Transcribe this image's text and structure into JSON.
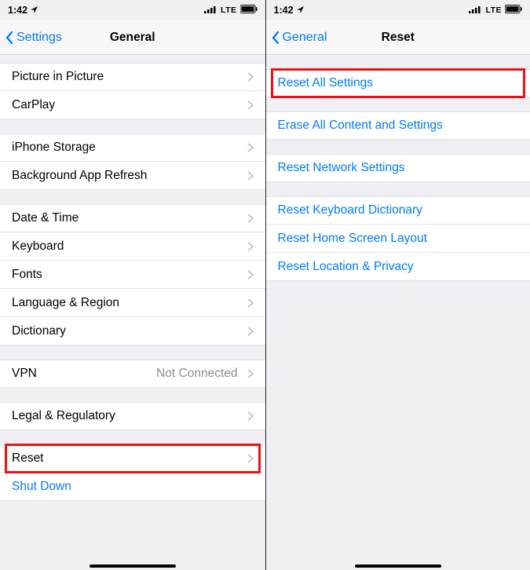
{
  "status": {
    "time": "1:42",
    "network": "LTE"
  },
  "left": {
    "back": "Settings",
    "title": "General",
    "groups": [
      [
        {
          "label": "Picture in Picture",
          "chev": true
        },
        {
          "label": "CarPlay",
          "chev": true
        }
      ],
      [
        {
          "label": "iPhone Storage",
          "chev": true
        },
        {
          "label": "Background App Refresh",
          "chev": true
        }
      ],
      [
        {
          "label": "Date & Time",
          "chev": true
        },
        {
          "label": "Keyboard",
          "chev": true
        },
        {
          "label": "Fonts",
          "chev": true
        },
        {
          "label": "Language & Region",
          "chev": true
        },
        {
          "label": "Dictionary",
          "chev": true
        }
      ],
      [
        {
          "label": "VPN",
          "detail": "Not Connected",
          "chev": true
        }
      ],
      [
        {
          "label": "Legal & Regulatory",
          "chev": true
        }
      ],
      [
        {
          "label": "Reset",
          "chev": true,
          "highlight": true
        },
        {
          "label": "Shut Down",
          "link": true
        }
      ]
    ]
  },
  "right": {
    "back": "General",
    "title": "Reset",
    "groups": [
      [
        {
          "label": "Reset All Settings",
          "link": true,
          "highlight": true
        }
      ],
      [
        {
          "label": "Erase All Content and Settings",
          "link": true
        }
      ],
      [
        {
          "label": "Reset Network Settings",
          "link": true
        }
      ],
      [
        {
          "label": "Reset Keyboard Dictionary",
          "link": true
        },
        {
          "label": "Reset Home Screen Layout",
          "link": true
        },
        {
          "label": "Reset Location & Privacy",
          "link": true
        }
      ]
    ]
  }
}
